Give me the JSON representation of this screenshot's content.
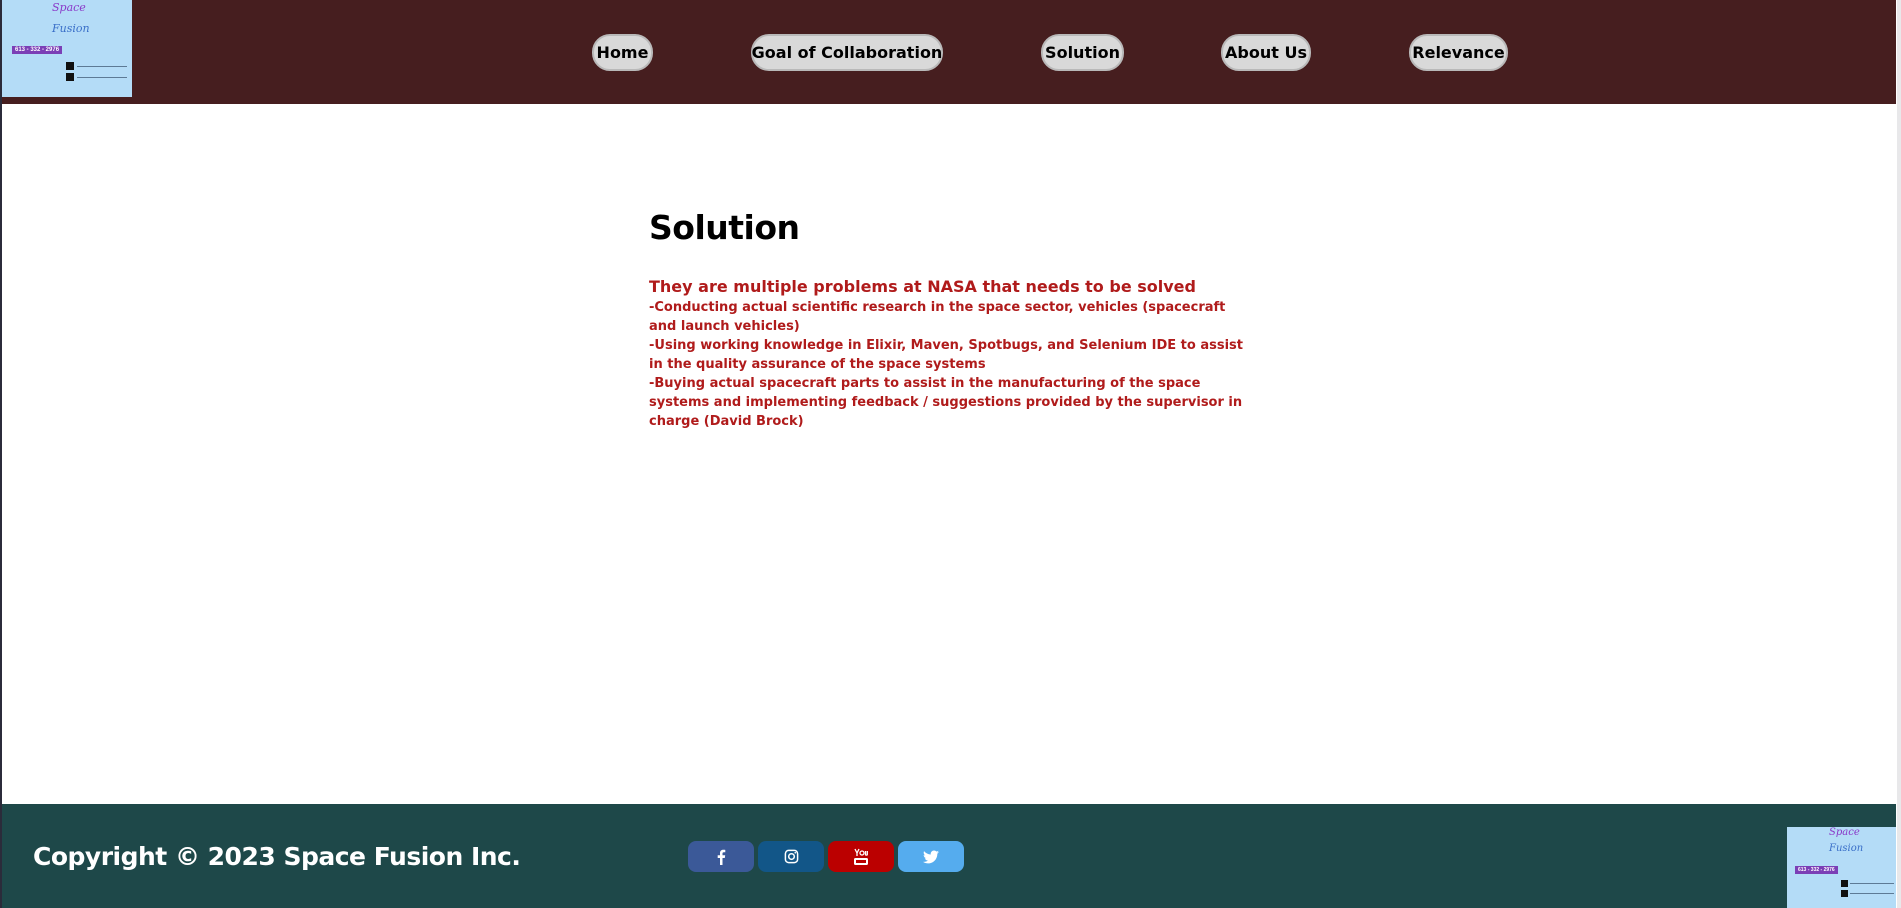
{
  "logo": {
    "line1": "Space",
    "line2": "Fusion",
    "phone": "613 - 332 - 2976",
    "icons": [
      "facebook-icon",
      "instagram-icon"
    ]
  },
  "nav": {
    "items": [
      {
        "label": "Home"
      },
      {
        "label": "Goal of Collaboration"
      },
      {
        "label": "Solution"
      },
      {
        "label": "About Us"
      },
      {
        "label": "Relevance"
      }
    ]
  },
  "main": {
    "title": "Solution",
    "lead": "They are multiple problems at NASA that needs to be solved",
    "items": [
      "-Conducting actual scientific research in the space sector, vehicles (spacecraft and launch vehicles)",
      "-Using working knowledge in Elixir, Maven, Spotbugs, and Selenium IDE to assist in the quality assurance of the space systems",
      "-Buying actual spacecraft parts to assist in the manufacturing of the space systems and implementing feedback / suggestions provided by the supervisor in charge (David Brock)"
    ]
  },
  "footer": {
    "copyright": "Copyright © 2023 Space Fusion Inc.",
    "social": [
      {
        "icon": "facebook-icon",
        "color": "#3b5998"
      },
      {
        "icon": "instagram-icon",
        "color": "#125688"
      },
      {
        "icon": "youtube-icon",
        "color": "#bb0000"
      },
      {
        "icon": "twitter-icon",
        "color": "#55acee"
      }
    ]
  },
  "colors": {
    "header_bg": "#461e1f",
    "footer_bg": "#1e4849",
    "accent_text": "#b01b1b",
    "logo_bg": "#b4dcf7"
  }
}
